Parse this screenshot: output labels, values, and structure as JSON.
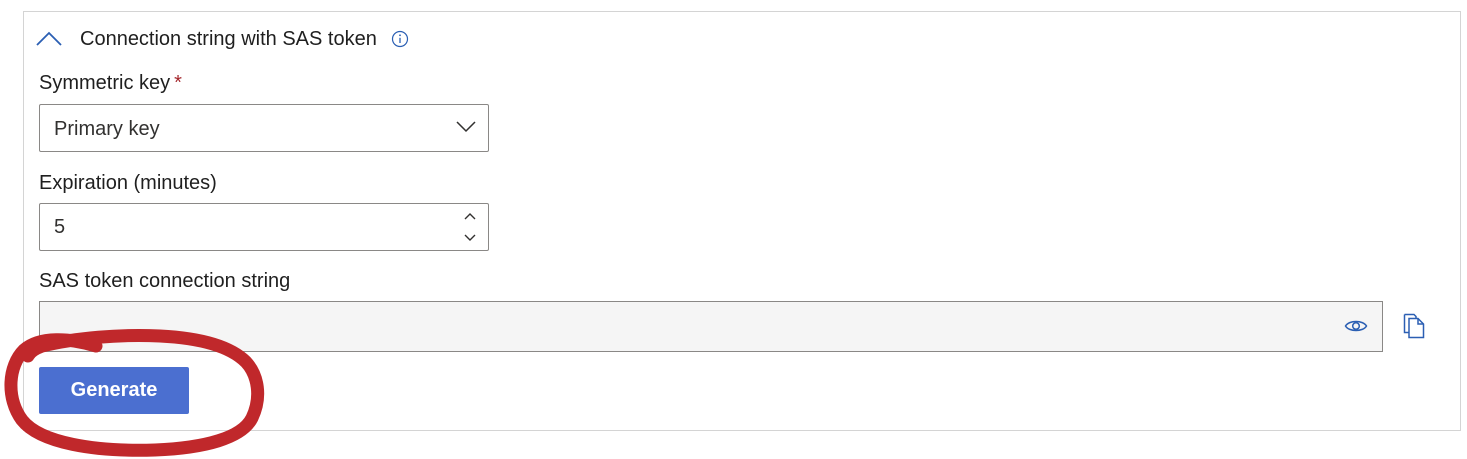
{
  "section": {
    "title": "Connection string with SAS token",
    "expand_icon": "chevron-up-icon",
    "info_icon": "info-icon"
  },
  "symmetric_key": {
    "label": "Symmetric key",
    "required_marker": "*",
    "selected": "Primary key"
  },
  "expiration": {
    "label": "Expiration (minutes)",
    "value": "5"
  },
  "sas_token": {
    "label": "SAS token connection string",
    "value": "",
    "show_icon": "eye-icon",
    "copy_icon": "copy-icon"
  },
  "generate_button": {
    "label": "Generate"
  },
  "colors": {
    "accent": "#4b6fd0",
    "required": "#a4262c",
    "annotation": "#c0282b"
  }
}
